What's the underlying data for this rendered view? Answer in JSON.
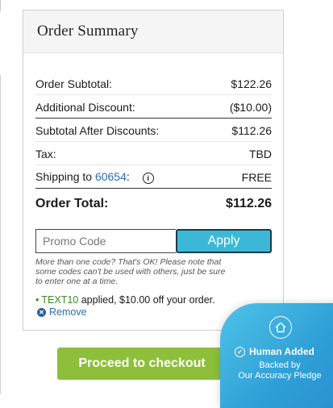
{
  "summary": {
    "title": "Order Summary",
    "rows": [
      {
        "label": "Order Subtotal:",
        "value": "$122.26"
      },
      {
        "label": "Additional Discount:",
        "value": "($10.00)"
      },
      {
        "label": "Subtotal After Discounts:",
        "value": "$112.26"
      },
      {
        "label": "Tax:",
        "value": "TBD"
      }
    ],
    "shipping": {
      "label_prefix": "Shipping to",
      "zip": "60654",
      "value": "FREE"
    },
    "total": {
      "label": "Order Total:",
      "value": "$112.26"
    }
  },
  "promo": {
    "placeholder": "Promo Code",
    "apply_label": "Apply",
    "note": "More than one code? That's OK! Please note that some codes can't be used with others, just be sure to enter one at a time.",
    "applied_code": "TEXT10",
    "applied_text": "applied, $10.00 off your order.",
    "remove_label": "Remove"
  },
  "checkout": {
    "label": "Proceed to checkout"
  },
  "badge": {
    "title": "Human Added",
    "subtitle_line1": "Backed by",
    "subtitle_line2": "Our Accuracy Pledge"
  },
  "colors": {
    "apply": "#3bb8d6",
    "checkout": "#8dbf3a",
    "link": "#2b6cb0",
    "promo_code": "#3a8b28",
    "badge": "#2e9fd6"
  }
}
